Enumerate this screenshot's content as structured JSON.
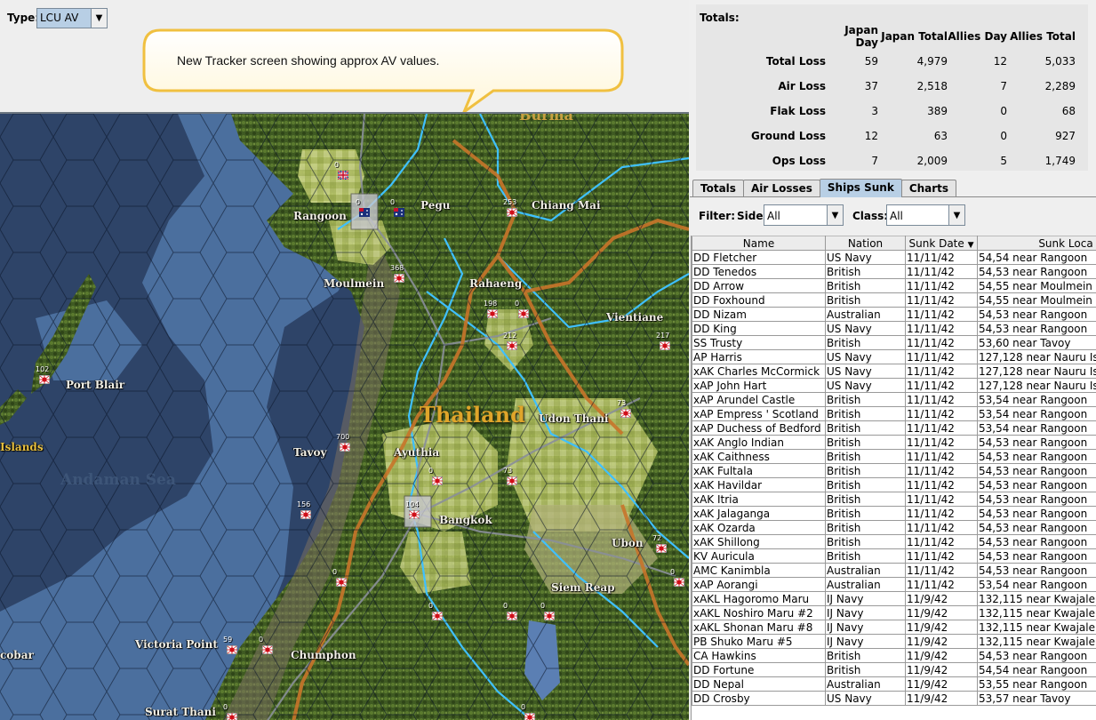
{
  "toolbar": {
    "type_label": "Type:",
    "type_value": "LCU AV"
  },
  "callout": {
    "text": "New Tracker screen showing approx AV values."
  },
  "map": {
    "places": [
      {
        "name": "Rangoon"
      },
      {
        "name": "Pegu"
      },
      {
        "name": "Chiang Mai"
      },
      {
        "name": "Moulmein"
      },
      {
        "name": "Rahaeng"
      },
      {
        "name": "Vientiane"
      },
      {
        "name": "Port Blair"
      },
      {
        "name": "Udon Thani"
      },
      {
        "name": "Islands"
      },
      {
        "name": "Tavoy"
      },
      {
        "name": "Ayuthia"
      },
      {
        "name": "Bangkok"
      },
      {
        "name": "Ubon"
      },
      {
        "name": "Siem Reap"
      },
      {
        "name": "Victoria Point"
      },
      {
        "name": "Chumphon"
      },
      {
        "name": "cobar"
      },
      {
        "name": "Surat Thani"
      },
      {
        "name": "Burma"
      }
    ],
    "country_label": "Thailand",
    "sea_label": "Andaman Sea",
    "unit_values": [
      "0",
      "0",
      "0",
      "253",
      "368",
      "198",
      "0",
      "212",
      "217",
      "102",
      "73",
      "700",
      "0",
      "73",
      "104",
      "156",
      "72",
      "0",
      "0",
      "0",
      "0",
      "0",
      "59",
      "0",
      "0",
      "0"
    ]
  },
  "totals": {
    "title": "Totals:",
    "headers": [
      "",
      "Japan Day",
      "Japan Total",
      "Allies Day",
      "Allies Total"
    ],
    "rows": [
      {
        "label": "Total Loss",
        "jday": "59",
        "jtotal": "4,979",
        "aday": "12",
        "atotal": "5,033"
      },
      {
        "label": "Air Loss",
        "jday": "37",
        "jtotal": "2,518",
        "aday": "7",
        "atotal": "2,289"
      },
      {
        "label": "Flak Loss",
        "jday": "3",
        "jtotal": "389",
        "aday": "0",
        "atotal": "68"
      },
      {
        "label": "Ground Loss",
        "jday": "12",
        "jtotal": "63",
        "aday": "0",
        "atotal": "927"
      },
      {
        "label": "Ops Loss",
        "jday": "7",
        "jtotal": "2,009",
        "aday": "5",
        "atotal": "1,749"
      }
    ]
  },
  "tabs": [
    {
      "label": "Totals",
      "active": false
    },
    {
      "label": "Air Losses",
      "active": false
    },
    {
      "label": "Ships Sunk",
      "active": true
    },
    {
      "label": "Charts",
      "active": false
    }
  ],
  "filters": {
    "filter_label": "Filter:",
    "side_label": "Side:",
    "side_value": "All",
    "class_label": "Class:",
    "class_value": "All"
  },
  "ships": {
    "columns": [
      "Name",
      "Nation",
      "Sunk Date",
      "Sunk Loca"
    ],
    "rows": [
      [
        "DD Fletcher",
        "US Navy",
        "11/11/42",
        "54,54 near Rangoon"
      ],
      [
        "DD Tenedos",
        "British",
        "11/11/42",
        "54,53 near Rangoon"
      ],
      [
        "DD Arrow",
        "British",
        "11/11/42",
        "54,55 near Moulmein"
      ],
      [
        "DD Foxhound",
        "British",
        "11/11/42",
        "54,55 near Moulmein"
      ],
      [
        "DD Nizam",
        "Australian",
        "11/11/42",
        "54,53 near Rangoon"
      ],
      [
        "DD King",
        "US Navy",
        "11/11/42",
        "54,53 near Rangoon"
      ],
      [
        "SS Trusty",
        "British",
        "11/11/42",
        "53,60 near Tavoy"
      ],
      [
        "AP Harris",
        "US Navy",
        "11/11/42",
        "127,128 near Nauru Isla"
      ],
      [
        "xAK Charles McCormick",
        "US Navy",
        "11/11/42",
        "127,128 near Nauru Isla"
      ],
      [
        "xAP John Hart",
        "US Navy",
        "11/11/42",
        "127,128 near Nauru Isla"
      ],
      [
        "xAP Arundel Castle",
        "British",
        "11/11/42",
        "53,54 near Rangoon"
      ],
      [
        "xAP Empress ' Scotland",
        "British",
        "11/11/42",
        "53,54 near Rangoon"
      ],
      [
        "xAP Duchess of Bedford",
        "British",
        "11/11/42",
        "53,54 near Rangoon"
      ],
      [
        "xAK Anglo Indian",
        "British",
        "11/11/42",
        "54,53 near Rangoon"
      ],
      [
        "xAK Caithness",
        "British",
        "11/11/42",
        "54,53 near Rangoon"
      ],
      [
        "xAK Fultala",
        "British",
        "11/11/42",
        "54,53 near Rangoon"
      ],
      [
        "xAK Havildar",
        "British",
        "11/11/42",
        "54,53 near Rangoon"
      ],
      [
        "xAK Itria",
        "British",
        "11/11/42",
        "54,53 near Rangoon"
      ],
      [
        "xAK Jalaganga",
        "British",
        "11/11/42",
        "54,53 near Rangoon"
      ],
      [
        "xAK Ozarda",
        "British",
        "11/11/42",
        "54,53 near Rangoon"
      ],
      [
        "xAK Shillong",
        "British",
        "11/11/42",
        "54,53 near Rangoon"
      ],
      [
        "KV Auricula",
        "British",
        "11/11/42",
        "54,53 near Rangoon"
      ],
      [
        "AMC Kanimbla",
        "Australian",
        "11/11/42",
        "54,53 near Rangoon"
      ],
      [
        "xAP Aorangi",
        "Australian",
        "11/11/42",
        "53,54 near Rangoon"
      ],
      [
        "xAKL Hagoromo Maru",
        "IJ Navy",
        "11/9/42",
        "132,115 near Kwajalein"
      ],
      [
        "xAKL Noshiro Maru #2",
        "IJ Navy",
        "11/9/42",
        "132,115 near Kwajalein"
      ],
      [
        "xAKL Shonan Maru #8",
        "IJ Navy",
        "11/9/42",
        "132,115 near Kwajalein"
      ],
      [
        "PB Shuko Maru #5",
        "IJ Navy",
        "11/9/42",
        "132,115 near Kwajalein"
      ],
      [
        "CA Hawkins",
        "British",
        "11/9/42",
        "54,53 near Rangoon"
      ],
      [
        "DD Fortune",
        "British",
        "11/9/42",
        "54,54 near Rangoon"
      ],
      [
        "DD Nepal",
        "Australian",
        "11/9/42",
        "53,55 near Rangoon"
      ],
      [
        "DD Crosby",
        "US Navy",
        "11/9/42",
        "53,57 near Tavoy"
      ]
    ]
  }
}
